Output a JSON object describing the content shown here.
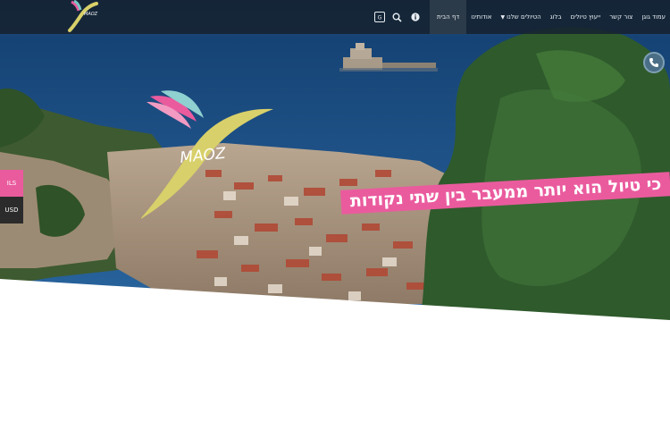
{
  "nav": {
    "items": [
      {
        "label": "דף הבית",
        "active": true,
        "dropdown": false
      },
      {
        "label": "אודותינו",
        "active": false,
        "dropdown": false
      },
      {
        "label": "הטיולים שלנו",
        "active": false,
        "dropdown": true
      },
      {
        "label": "בלוג",
        "active": false,
        "dropdown": false
      },
      {
        "label": "ייעוץ טיולים",
        "active": false,
        "dropdown": false
      },
      {
        "label": "צור קשר",
        "active": false,
        "dropdown": false
      },
      {
        "label": "עמוד גוגן",
        "active": false,
        "dropdown": false
      }
    ],
    "icons": [
      "info-icon",
      "search-icon",
      "translate-icon"
    ]
  },
  "logo": {
    "small_text": "MAOZ",
    "big_text": "MAOZ"
  },
  "hero": {
    "slogan": "כי טיול הוא יותר ממעבר בין שתי נקודות"
  },
  "currency": {
    "options": [
      "ILS",
      "USD"
    ],
    "selected": "ILS"
  },
  "colors": {
    "accent_pink": "#ea5b9e",
    "logo_yellow": "#d8d06a",
    "nav_bg": "#162230",
    "sea": "#1f4f86"
  }
}
